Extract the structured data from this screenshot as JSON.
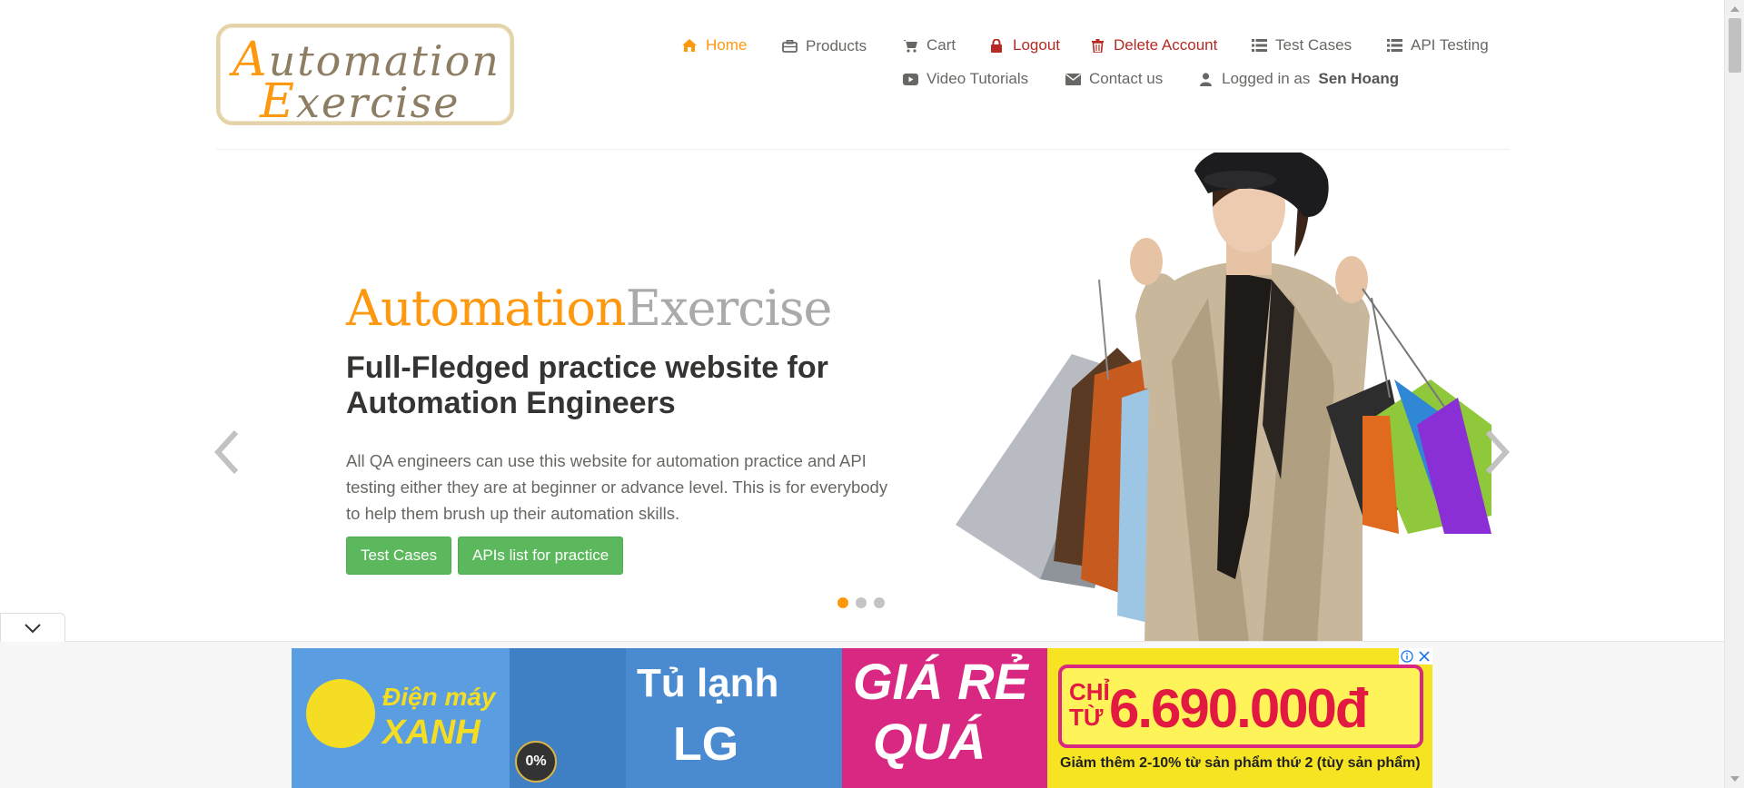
{
  "logo": {
    "line1_first": "A",
    "line1_rest": "utomation",
    "line2_first": "E",
    "line2_rest": "xercise"
  },
  "nav": {
    "home": "Home",
    "products": "Products",
    "cart": "Cart",
    "logout": "Logout",
    "delete_account": "Delete Account",
    "test_cases": "Test Cases",
    "api_testing": "API Testing",
    "video_tutorials": "Video Tutorials",
    "contact_us": "Contact us",
    "logged_in_prefix": "Logged in as",
    "username": "Sen Hoang"
  },
  "hero": {
    "title_part1": "Automation",
    "title_part2": "Exercise",
    "subtitle": "Full-Fledged practice website for Automation Engineers",
    "description": "All QA engineers can use this website for automation practice and API testing either they are at beginner or advance level. This is for everybody to help them brush up their automation skills.",
    "btn_test_cases": "Test Cases",
    "btn_apis": "APIs list for practice",
    "active_slide": 1,
    "slide_count": 3
  },
  "ad": {
    "brand_line1": "Điện máy",
    "brand_line2": "XANH",
    "badge": "0%",
    "product_line1": "Tủ lạnh",
    "product_line2": "LG",
    "deal_line1": "GIÁ RẺ",
    "deal_line2": "QUÁ",
    "chi": "CHỈ",
    "tu": "TỪ",
    "price": "6.690.000đ",
    "note": "Giảm thêm 2-10% từ sản phẩm thứ 2 (tùy sản phẩm)"
  },
  "colors": {
    "accent": "#fe980f",
    "danger": "#b72a24",
    "button": "#5cb85c",
    "text": "#696763"
  }
}
